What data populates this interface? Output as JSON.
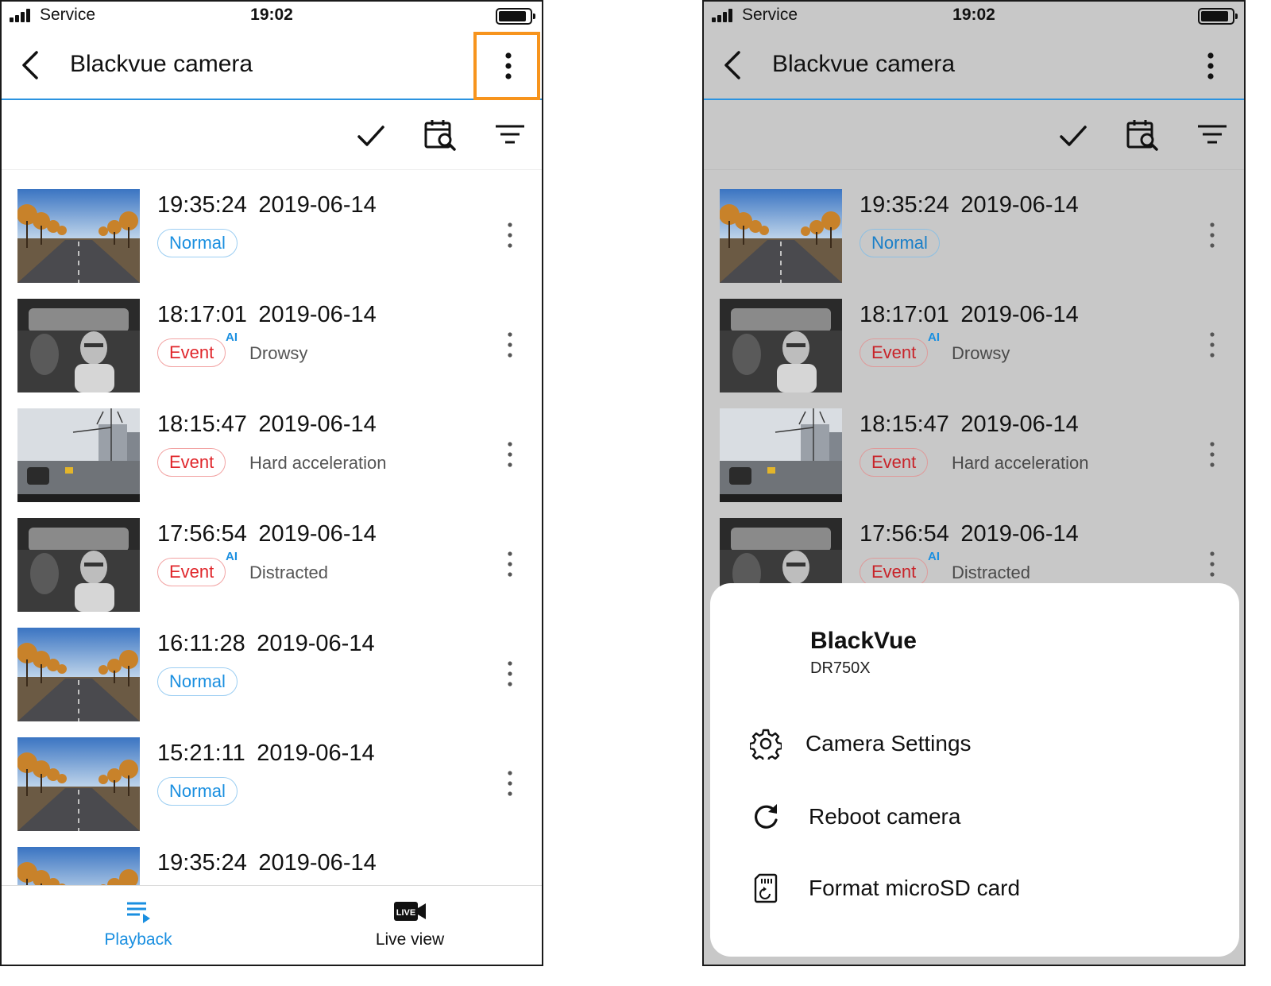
{
  "status": {
    "carrier": "Service",
    "time": "19:02"
  },
  "header": {
    "title": "Blackvue camera"
  },
  "list": [
    {
      "time": "19:35:24",
      "date": "2019-06-14",
      "type": "Normal",
      "ai": false,
      "desc": "",
      "thumb": "road"
    },
    {
      "time": "18:17:01",
      "date": "2019-06-14",
      "type": "Event",
      "ai": true,
      "desc": "Drowsy",
      "thumb": "cabin"
    },
    {
      "time": "18:15:47",
      "date": "2019-06-14",
      "type": "Event",
      "ai": false,
      "desc": "Hard acceleration",
      "thumb": "street"
    },
    {
      "time": "17:56:54",
      "date": "2019-06-14",
      "type": "Event",
      "ai": true,
      "desc": "Distracted",
      "thumb": "cabin"
    },
    {
      "time": "16:11:28",
      "date": "2019-06-14",
      "type": "Normal",
      "ai": false,
      "desc": "",
      "thumb": "road"
    },
    {
      "time": "15:21:11",
      "date": "2019-06-14",
      "type": "Normal",
      "ai": false,
      "desc": "",
      "thumb": "road"
    },
    {
      "time": "19:35:24",
      "date": "2019-06-14",
      "type": "",
      "ai": false,
      "desc": "",
      "thumb": "road"
    }
  ],
  "ai_label": "AI",
  "nav": {
    "playback": "Playback",
    "live": "Live view",
    "live_icon_text": "LIVE"
  },
  "sheet": {
    "brand": "BlackVue",
    "model": "DR750X",
    "items": [
      {
        "label": "Camera Settings",
        "icon": "gear-icon"
      },
      {
        "label": "Reboot camera",
        "icon": "refresh-icon"
      },
      {
        "label": "Format microSD card",
        "icon": "sd-card-icon"
      }
    ]
  },
  "colors": {
    "accent": "#2b93e0",
    "highlight": "#f7941d",
    "event": "#e0262b",
    "normal": "#1a8fe0"
  }
}
